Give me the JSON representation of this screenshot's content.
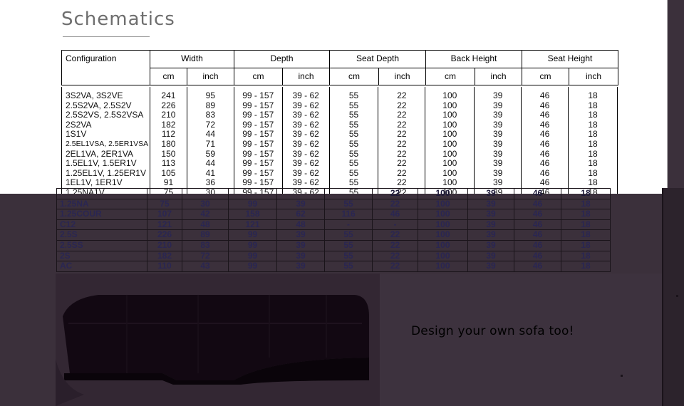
{
  "page": {
    "title": "Schematics",
    "tagline": "Design your own sofa too!"
  },
  "table": {
    "config_header": "Configuration",
    "groups": [
      "Width",
      "Depth",
      "Seat Depth",
      "Back Height",
      "Seat Height"
    ],
    "units": [
      "cm",
      "inch",
      "cm",
      "inch",
      "cm",
      "inch",
      "cm",
      "inch",
      "cm",
      "inch"
    ],
    "rows": [
      {
        "config": "3S2VA, 3S2VE",
        "values": [
          "241",
          "95",
          "99 - 157",
          "39 - 62",
          "55",
          "22",
          "100",
          "39",
          "46",
          "18"
        ]
      },
      {
        "config": "2.5S2VA, 2.5S2V",
        "values": [
          "226",
          "89",
          "99 - 157",
          "39 - 62",
          "55",
          "22",
          "100",
          "39",
          "46",
          "18"
        ]
      },
      {
        "config": "2.5S2VS, 2.5S2VSA",
        "values": [
          "210",
          "83",
          "99 - 157",
          "39 - 62",
          "55",
          "22",
          "100",
          "39",
          "46",
          "18"
        ]
      },
      {
        "config": "2S2VA",
        "values": [
          "182",
          "72",
          "99 - 157",
          "39 - 62",
          "55",
          "22",
          "100",
          "39",
          "46",
          "18"
        ]
      },
      {
        "config": "1S1V",
        "values": [
          "112",
          "44",
          "99 - 157",
          "39 - 62",
          "55",
          "22",
          "100",
          "39",
          "46",
          "18"
        ]
      },
      {
        "config": "2.5EL1VSA, 2.5ER1VSA",
        "values": [
          "180",
          "71",
          "99 - 157",
          "39 - 62",
          "55",
          "22",
          "100",
          "39",
          "46",
          "18"
        ]
      },
      {
        "config": "2EL1VA, 2ER1VA",
        "values": [
          "150",
          "59",
          "99 - 157",
          "39 - 62",
          "55",
          "22",
          "100",
          "39",
          "46",
          "18"
        ]
      },
      {
        "config": "1.5EL1V, 1.5ER1V",
        "values": [
          "113",
          "44",
          "99 - 157",
          "39 - 62",
          "55",
          "22",
          "100",
          "39",
          "46",
          "18"
        ]
      },
      {
        "config": "1.25EL1V, 1.25ER1V",
        "values": [
          "105",
          "41",
          "99 - 157",
          "39 - 62",
          "55",
          "22",
          "100",
          "39",
          "46",
          "18"
        ]
      },
      {
        "config": "1EL1V, 1ER1V",
        "values": [
          "91",
          "36",
          "99 - 157",
          "39 - 62",
          "55",
          "22",
          "100",
          "39",
          "46",
          "18"
        ]
      },
      {
        "config": "1.25NA1V",
        "values": [
          "75",
          "30",
          "99 - 157",
          "39 - 62",
          "55",
          "22",
          "100",
          "39",
          "46",
          "18"
        ]
      }
    ],
    "dark_rows": [
      {
        "config": "",
        "values": [
          "",
          "",
          "",
          "",
          "",
          "22",
          "100",
          "39",
          "46",
          "18"
        ]
      },
      {
        "config": "1.25NA",
        "values": [
          "75",
          "30",
          "99",
          "39",
          "55",
          "22",
          "100",
          "39",
          "46",
          "18"
        ]
      },
      {
        "config": "1.25COUR",
        "values": [
          "107",
          "42",
          "158",
          "62",
          "116",
          "46",
          "100",
          "39",
          "46",
          "18"
        ]
      },
      {
        "config": "C12",
        "values": [
          "121",
          "48",
          "121",
          "48",
          "-",
          "-",
          "100",
          "39",
          "46",
          "18"
        ]
      },
      {
        "config": "2.5S",
        "values": [
          "226",
          "89",
          "99",
          "39",
          "55",
          "22",
          "100",
          "39",
          "46",
          "18"
        ]
      },
      {
        "config": "2.5SS",
        "values": [
          "210",
          "83",
          "99",
          "39",
          "55",
          "22",
          "100",
          "39",
          "46",
          "18"
        ]
      },
      {
        "config": "2S",
        "values": [
          "182",
          "72",
          "99",
          "39",
          "55",
          "22",
          "100",
          "39",
          "46",
          "18"
        ]
      },
      {
        "config": "AC",
        "values": [
          "110",
          "43",
          "99",
          "39",
          "55",
          "22",
          "100",
          "39",
          "46",
          "18"
        ]
      }
    ]
  },
  "image": {
    "subject": "sofa-photo"
  }
}
